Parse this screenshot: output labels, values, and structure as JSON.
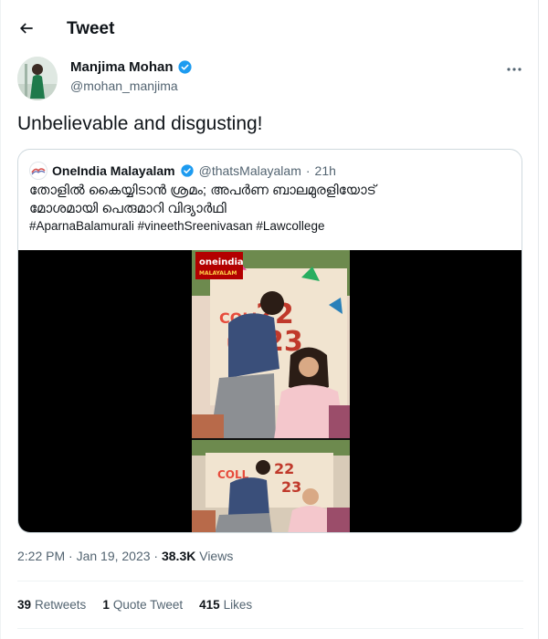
{
  "header": {
    "title": "Tweet"
  },
  "author": {
    "name": "Manjima Mohan",
    "handle": "@mohan_manjima",
    "verified": true
  },
  "tweet": {
    "text": "Unbelievable and disgusting!"
  },
  "quote": {
    "name": "OneIndia Malayalam",
    "handle": "@thatsMalayalam",
    "separator": "·",
    "time": "21h",
    "line1": "തോളിൽ കൈയ്യിടാൻ ശ്രമം; അപർണ ബാലമുരളിയോട്",
    "line2": "മോശമായി പെരുമാറി വിദ്യാർഥി",
    "hashtags": "#AparnaBalamurali #vineethSreenivasan #Lawcollege",
    "video_logo": "oneindia",
    "video_logo_sub": "MALAYALAM"
  },
  "meta": {
    "time": "2:22 PM · Jan 19, 2023 · ",
    "views_count": "38.3K",
    "views_label": " Views"
  },
  "stats": {
    "retweets_count": "39",
    "retweets_label": "Retweets",
    "quotes_count": "1",
    "quotes_label": "Quote Tweet",
    "likes_count": "415",
    "likes_label": "Likes"
  },
  "colors": {
    "verified": "#1d9bf0",
    "muted": "#536471",
    "text": "#0f1419",
    "border": "#cfd9de"
  },
  "icons": {
    "back": "back-arrow-icon",
    "more": "more-horizontal-icon",
    "verified": "verified-badge-icon"
  }
}
